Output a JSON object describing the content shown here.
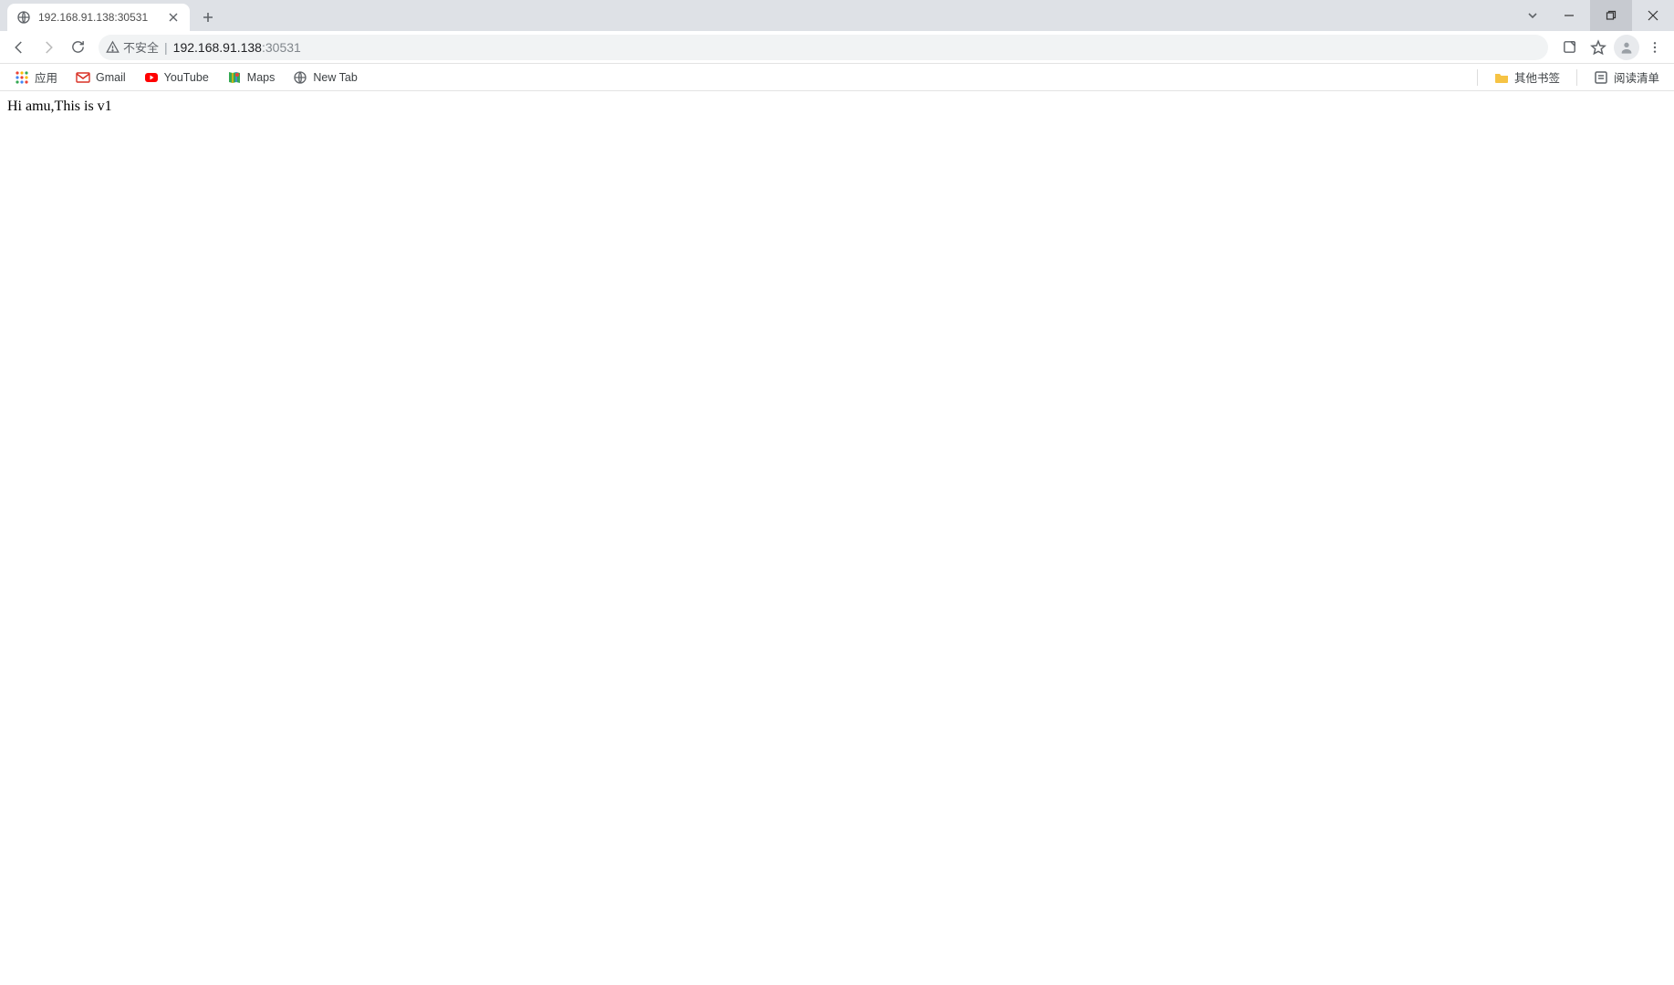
{
  "tab": {
    "title": "192.168.91.138:30531"
  },
  "omnibox": {
    "security_label": "不安全",
    "url_host": "192.168.91.138",
    "url_port": ":30531"
  },
  "bookmarks": {
    "apps": "应用",
    "gmail": "Gmail",
    "youtube": "YouTube",
    "maps": "Maps",
    "newtab": "New Tab",
    "other": "其他书签",
    "reading_list": "阅读清单"
  },
  "page": {
    "body_text": "Hi amu,This is v1"
  }
}
